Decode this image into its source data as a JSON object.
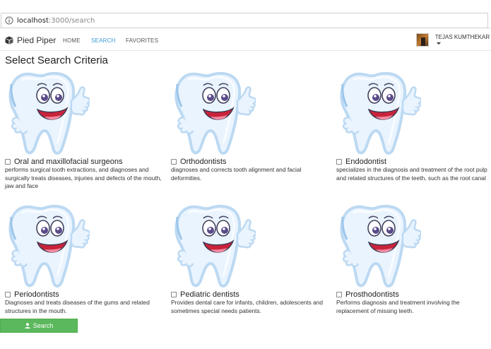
{
  "browser": {
    "url_host": "localhost",
    "url_path": ":3000/search"
  },
  "navbar": {
    "brand": "Pied Piper",
    "links": [
      {
        "label": "HOME",
        "active": false
      },
      {
        "label": "SEARCH",
        "active": true
      },
      {
        "label": "FAVORITES",
        "active": false
      }
    ],
    "user_name": "TEJAS KUMTHEKAR"
  },
  "page": {
    "title": "Select Search Criteria"
  },
  "specialties": [
    {
      "name": "Oral and maxillofacial surgeons",
      "checked": false,
      "icon": "smiling-tooth-icon",
      "description": "performs surgical tooth extractions, and diagnoses and surgically treats diseases, injuries and defects of the mouth, jaw and face"
    },
    {
      "name": "Orthodontists",
      "checked": false,
      "icon": "smiling-tooth-icon",
      "description": "diagnoses and corrects tooth alignment and facial deformities."
    },
    {
      "name": "Endodontist",
      "checked": false,
      "icon": "smiling-tooth-icon",
      "description": "specializes in the diagnosis and treatment of the root pulp and related structures of the teeth, such as the root canal"
    },
    {
      "name": "Periodontists",
      "checked": false,
      "icon": "smiling-tooth-icon",
      "description": "Diagnoses and treats diseases of the gums and related structures in the mouth."
    },
    {
      "name": "Pediatric dentists",
      "checked": false,
      "icon": "smiling-tooth-icon",
      "description": "Provides dental care for infants, children, adolescents and sometimes special needs patients."
    },
    {
      "name": "Prosthodontists",
      "checked": false,
      "icon": "smiling-tooth-icon",
      "description": "Performs diagnosis and treatment involving the replacement of missing teeth."
    }
  ],
  "actions": {
    "search_label": "Search"
  },
  "colors": {
    "accent": "#3b9ad9",
    "button": "#5cb85c"
  }
}
